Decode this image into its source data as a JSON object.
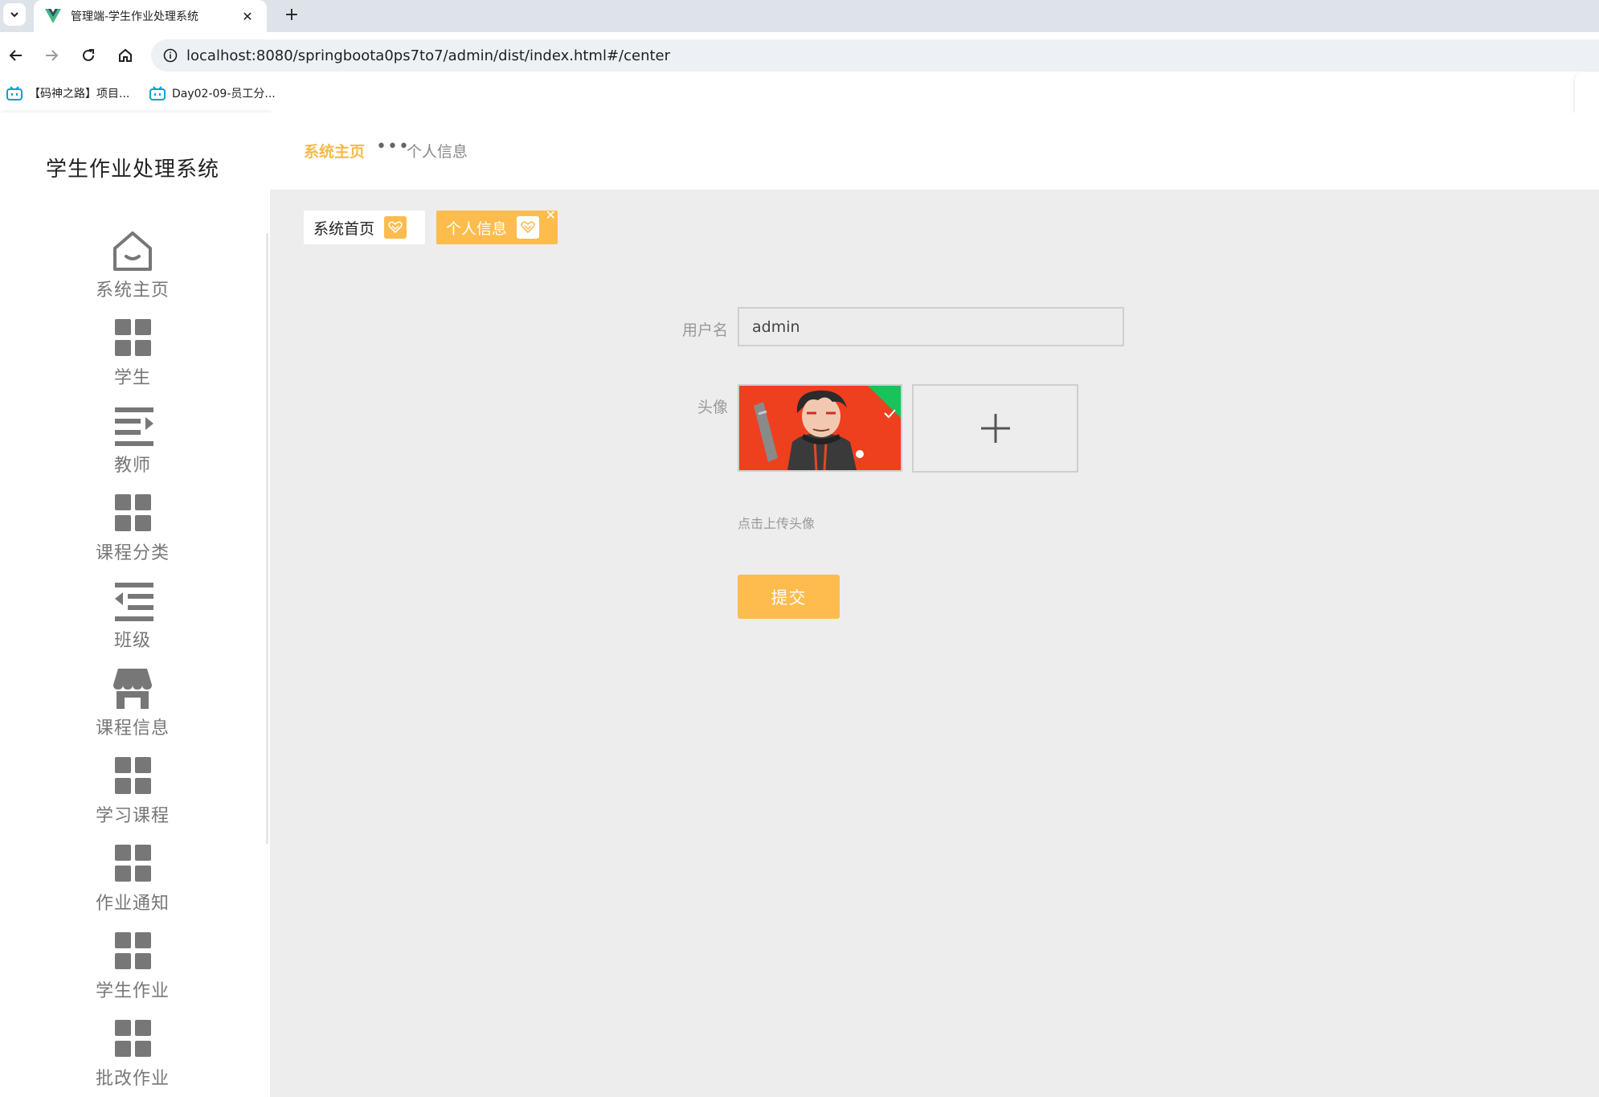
{
  "browser": {
    "tab_title": "管理端-学生作业处理系统",
    "tab_close": "✕",
    "new_tab": "+",
    "url": "localhost:8080/springboota0ps7to7/admin/dist/index.html#/center",
    "bookmarks": [
      {
        "label": "【码神之路】项目..."
      },
      {
        "label": "Day02-09-员工分..."
      }
    ],
    "accent_color": "#00b4ff"
  },
  "sidebar": {
    "title": "学生作业处理系统",
    "items": [
      {
        "label": "系统主页",
        "icon": "home-icon"
      },
      {
        "label": "学生",
        "icon": "grid-icon"
      },
      {
        "label": "教师",
        "icon": "indent-icon"
      },
      {
        "label": "课程分类",
        "icon": "grid-icon"
      },
      {
        "label": "班级",
        "icon": "outdent-icon"
      },
      {
        "label": "课程信息",
        "icon": "shop-icon"
      },
      {
        "label": "学习课程",
        "icon": "grid-icon"
      },
      {
        "label": "作业通知",
        "icon": "grid-icon"
      },
      {
        "label": "学生作业",
        "icon": "grid-icon"
      },
      {
        "label": "批改作业",
        "icon": "grid-icon"
      }
    ]
  },
  "header": {
    "breadcrumb_home": "系统主页",
    "breadcrumb_separator": "•••",
    "breadcrumb_current": "个人信息"
  },
  "tags": [
    {
      "label": "系统首页",
      "active": false
    },
    {
      "label": "个人信息",
      "active": true,
      "close": "✕"
    }
  ],
  "form": {
    "username_label": "用户名",
    "username_value": "admin",
    "avatar_label": "头像",
    "upload_plus": "+",
    "upload_hint": "点击上传头像",
    "submit_label": "提交"
  },
  "colors": {
    "primary": "#fdbc4d",
    "breadcrumb_home": "#f5b94c",
    "background": "#ededed"
  }
}
